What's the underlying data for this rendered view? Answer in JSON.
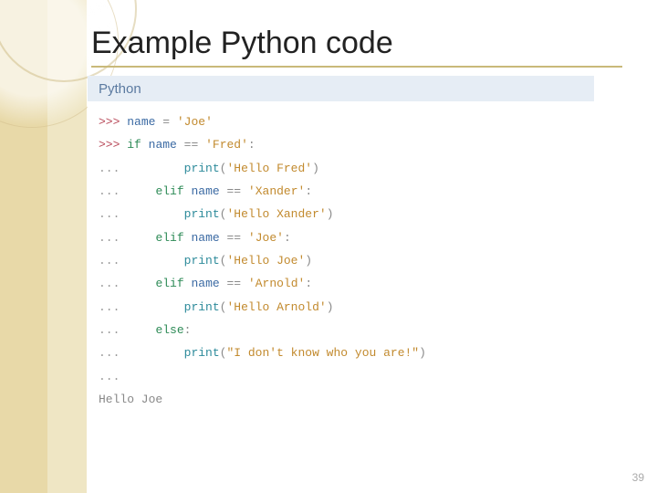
{
  "slide": {
    "title": "Example Python code",
    "page_number": "39",
    "code": {
      "language_label": "Python",
      "lines": [
        {
          "prompt": ">>>",
          "tokens": [
            {
              "t": "name",
              "v": "name"
            },
            {
              "t": "sp",
              "v": " "
            },
            {
              "t": "op",
              "v": "="
            },
            {
              "t": "sp",
              "v": " "
            },
            {
              "t": "str",
              "v": "'Joe'"
            }
          ]
        },
        {
          "prompt": ">>>",
          "tokens": [
            {
              "t": "kw",
              "v": "if"
            },
            {
              "t": "sp",
              "v": " "
            },
            {
              "t": "name",
              "v": "name"
            },
            {
              "t": "sp",
              "v": " "
            },
            {
              "t": "op",
              "v": "=="
            },
            {
              "t": "sp",
              "v": " "
            },
            {
              "t": "str",
              "v": "'Fred'"
            },
            {
              "t": "op",
              "v": ":"
            }
          ]
        },
        {
          "prompt": "...",
          "indent": 2,
          "tokens": [
            {
              "t": "func",
              "v": "print"
            },
            {
              "t": "paren",
              "v": "("
            },
            {
              "t": "str",
              "v": "'Hello Fred'"
            },
            {
              "t": "paren",
              "v": ")"
            }
          ]
        },
        {
          "prompt": "...",
          "indent": 1,
          "tokens": [
            {
              "t": "kw",
              "v": "elif"
            },
            {
              "t": "sp",
              "v": " "
            },
            {
              "t": "name",
              "v": "name"
            },
            {
              "t": "sp",
              "v": " "
            },
            {
              "t": "op",
              "v": "=="
            },
            {
              "t": "sp",
              "v": " "
            },
            {
              "t": "str",
              "v": "'Xander'"
            },
            {
              "t": "op",
              "v": ":"
            }
          ]
        },
        {
          "prompt": "...",
          "indent": 2,
          "tokens": [
            {
              "t": "func",
              "v": "print"
            },
            {
              "t": "paren",
              "v": "("
            },
            {
              "t": "str",
              "v": "'Hello Xander'"
            },
            {
              "t": "paren",
              "v": ")"
            }
          ]
        },
        {
          "prompt": "...",
          "indent": 1,
          "tokens": [
            {
              "t": "kw",
              "v": "elif"
            },
            {
              "t": "sp",
              "v": " "
            },
            {
              "t": "name",
              "v": "name"
            },
            {
              "t": "sp",
              "v": " "
            },
            {
              "t": "op",
              "v": "=="
            },
            {
              "t": "sp",
              "v": " "
            },
            {
              "t": "str",
              "v": "'Joe'"
            },
            {
              "t": "op",
              "v": ":"
            }
          ]
        },
        {
          "prompt": "...",
          "indent": 2,
          "tokens": [
            {
              "t": "func",
              "v": "print"
            },
            {
              "t": "paren",
              "v": "("
            },
            {
              "t": "str",
              "v": "'Hello Joe'"
            },
            {
              "t": "paren",
              "v": ")"
            }
          ]
        },
        {
          "prompt": "...",
          "indent": 1,
          "tokens": [
            {
              "t": "kw",
              "v": "elif"
            },
            {
              "t": "sp",
              "v": " "
            },
            {
              "t": "name",
              "v": "name"
            },
            {
              "t": "sp",
              "v": " "
            },
            {
              "t": "op",
              "v": "=="
            },
            {
              "t": "sp",
              "v": " "
            },
            {
              "t": "str",
              "v": "'Arnold'"
            },
            {
              "t": "op",
              "v": ":"
            }
          ]
        },
        {
          "prompt": "...",
          "indent": 2,
          "tokens": [
            {
              "t": "func",
              "v": "print"
            },
            {
              "t": "paren",
              "v": "("
            },
            {
              "t": "str",
              "v": "'Hello Arnold'"
            },
            {
              "t": "paren",
              "v": ")"
            }
          ]
        },
        {
          "prompt": "...",
          "indent": 1,
          "tokens": [
            {
              "t": "kw",
              "v": "else"
            },
            {
              "t": "op",
              "v": ":"
            }
          ]
        },
        {
          "prompt": "...",
          "indent": 2,
          "tokens": [
            {
              "t": "func",
              "v": "print"
            },
            {
              "t": "paren",
              "v": "("
            },
            {
              "t": "str",
              "v": "\"I don't know who you are!\""
            },
            {
              "t": "paren",
              "v": ")"
            }
          ]
        },
        {
          "prompt": "...",
          "tokens": []
        },
        {
          "prompt": "",
          "output": "Hello Joe"
        }
      ]
    }
  }
}
